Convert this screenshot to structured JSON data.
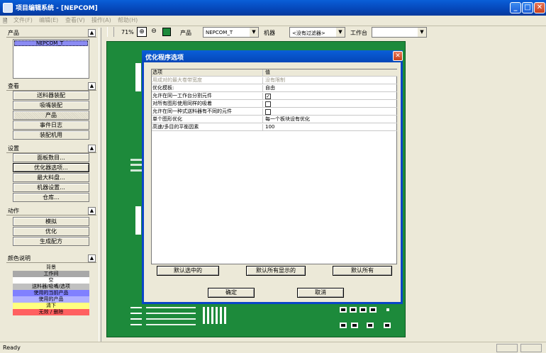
{
  "window": {
    "title": "项目编辑系统 - [NEPCOM]",
    "min": "_",
    "max": "□",
    "close": "✕"
  },
  "menu": [
    "文件(F)",
    "编辑(E)",
    "查看(V)",
    "操作(A)",
    "帮助(H)"
  ],
  "sidebar": {
    "product": {
      "title": "产品",
      "items": [
        "NEPCOM_T"
      ]
    },
    "view": {
      "title": "查看",
      "buttons": [
        "送料器装配",
        "吸嘴装配",
        "产品",
        "事件日志",
        "装配机用"
      ]
    },
    "settings": {
      "title": "设置",
      "buttons": [
        "面板数目...",
        "优化器选项...",
        "最大料盘...",
        "机器设置...",
        "仓库..."
      ]
    },
    "actions": {
      "title": "动作",
      "buttons": [
        "模拟",
        "优化",
        "生成配方"
      ]
    },
    "legend": {
      "title": "颜色说明",
      "items": [
        "背景",
        "工作间",
        "空",
        "送料器/吸嘴/选项",
        "使用的当前产品",
        "使用的产品",
        "清下",
        "无效 / 删除"
      ],
      "colors": [
        "#ece9d8",
        "#a8a8a8",
        "#ffffff",
        "#c0c0c0",
        "#8080ff",
        "#b0b0ff",
        "#ffff80",
        "#ff6060"
      ]
    }
  },
  "toolbar": {
    "zoom": "71%",
    "product_label": "产品",
    "product_value": "NEPCOM_T",
    "machine_label": "机器",
    "machine_value": "<没有过滤器>",
    "station_label": "工作台",
    "station_value": ""
  },
  "dialog": {
    "title": "优化程序选项",
    "col_option": "选项",
    "col_value": "值",
    "rows": [
      {
        "option": "用成对的最大卷带宽度",
        "value": "没有限制",
        "type": "text",
        "disabled": true
      },
      {
        "option": "优化模板:",
        "value": "自由",
        "type": "text"
      },
      {
        "option": "允许在同一工作台分割元件",
        "value": "✓",
        "type": "check"
      },
      {
        "option": "对所有图形使用同样的吸着",
        "value": "",
        "type": "check"
      },
      {
        "option": "允许在同一种式送料器有不同的元件",
        "value": "",
        "type": "check"
      },
      {
        "option": "单个图形优化",
        "value": "每一个板块设有优化",
        "type": "text"
      },
      {
        "option": "高速/多目的平衡因素",
        "value": "100",
        "type": "text"
      }
    ],
    "btn_default_selected": "默认选中的",
    "btn_default_shown": "默认所有显示的",
    "btn_default_all": "默认所有",
    "ok": "确定",
    "cancel": "取消"
  },
  "status": {
    "text": "Ready"
  }
}
